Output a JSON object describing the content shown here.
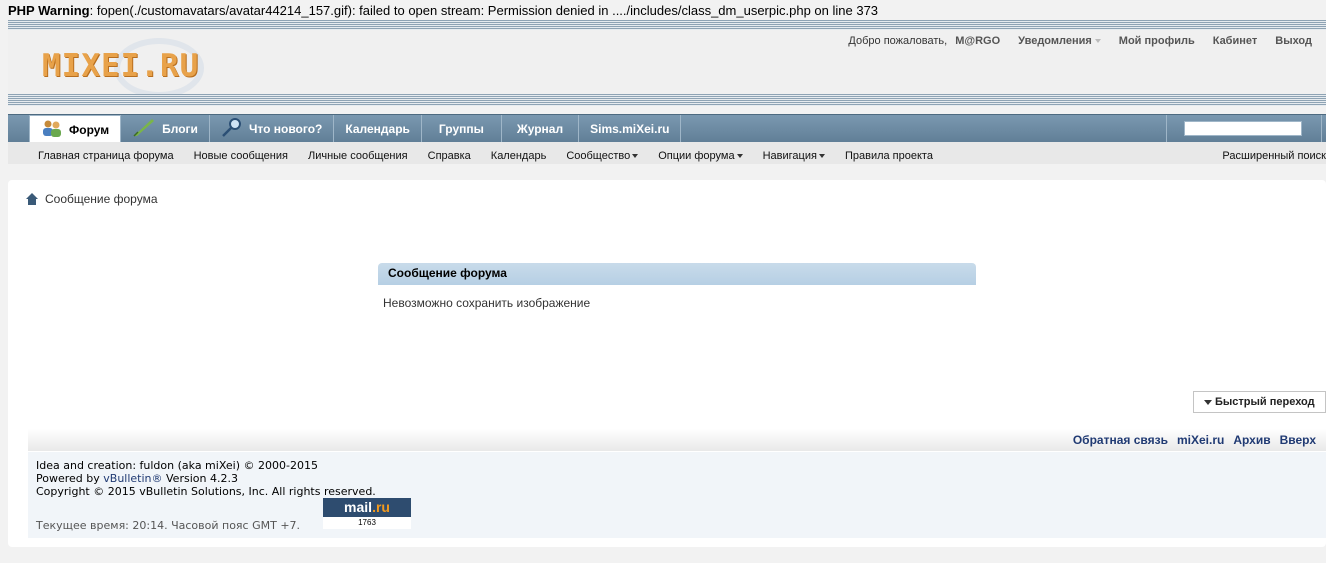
{
  "warning": {
    "label": "PHP Warning",
    "message": ": fopen(./customavatars/avatar44214_157.gif): failed to open stream: Permission denied in ..../includes/class_dm_userpic.php on line 373"
  },
  "logo": {
    "text": "MIXEI.RU"
  },
  "toplinks": {
    "welcome": "Добро пожаловать,",
    "username": "M@RGO",
    "notifications": "Уведомления",
    "profile": "Мой профиль",
    "cabinet": "Кабинет",
    "logout": "Выход"
  },
  "navtabs": [
    {
      "label": "Форум"
    },
    {
      "label": "Блоги"
    },
    {
      "label": "Что нового?"
    },
    {
      "label": "Календарь"
    },
    {
      "label": "Группы"
    },
    {
      "label": "Журнал"
    },
    {
      "label": "Sims.miXei.ru"
    }
  ],
  "subnav": {
    "items": [
      "Главная страница форума",
      "Новые сообщения",
      "Личные сообщения",
      "Справка",
      "Календарь",
      "Сообщество",
      "Опции форума",
      "Навигация",
      "Правила проекта"
    ],
    "advanced_search": "Расширенный поиск"
  },
  "breadcrumb": {
    "label": "Сообщение форума"
  },
  "message": {
    "title": "Сообщение форума",
    "body": "Невозможно сохранить изображение"
  },
  "quick_nav": {
    "label": "Быстрый переход"
  },
  "footer": {
    "links": [
      "Обратная связь",
      "miXei.ru",
      "Архив",
      "Вверх"
    ],
    "line1": "Idea and creation: fuldon (aka miXei) © 2000-2015",
    "powered_prefix": "Powered by ",
    "powered_link": "vBulletin®",
    "powered_suffix": " Version 4.2.3",
    "copyright": "Copyright © 2015 vBulletin Solutions, Inc. All rights reserved.",
    "time_label": "Текущее время: ",
    "time_value": "20:14",
    "timezone": ". Часовой пояс GMT +7.",
    "counter_name_a": "mail",
    "counter_name_b": ".ru",
    "counter_value": "1763"
  },
  "colors": {
    "nav_bar": "#6f8ea7",
    "message_header": "#bfd5e8",
    "link_blue": "#203a73",
    "logo_orange": "#e8a24a"
  }
}
